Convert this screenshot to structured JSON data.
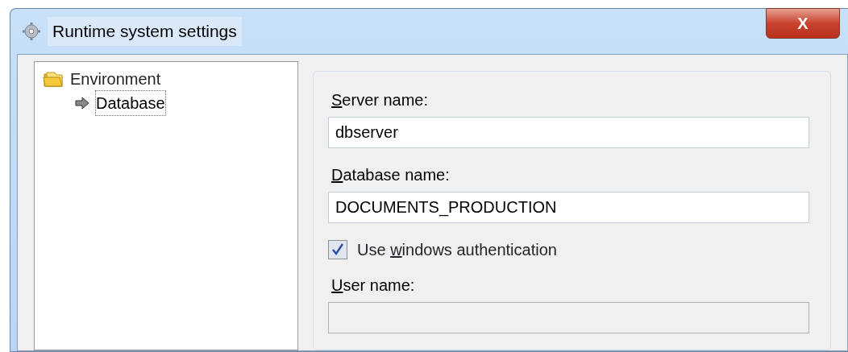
{
  "window": {
    "title": "Runtime system settings",
    "close_label": "X"
  },
  "tree": [
    {
      "label": "Environment",
      "kind": "folder",
      "selected": false,
      "children": [
        {
          "label": "Database",
          "kind": "arrow",
          "selected": true
        }
      ]
    }
  ],
  "form": [
    {
      "kind": "field",
      "label": [
        {
          "text": "S",
          "underlined": true
        },
        {
          "text": "erver name:",
          "underlined": false
        }
      ],
      "value": "dbserver",
      "disabled": false
    },
    {
      "kind": "field",
      "label": [
        {
          "text": "D",
          "underlined": true
        },
        {
          "text": "atabase name:",
          "underlined": false
        }
      ],
      "value": "DOCUMENTS_PRODUCTION",
      "disabled": false
    },
    {
      "kind": "checkbox",
      "label": [
        {
          "text": "Use ",
          "underlined": false
        },
        {
          "text": "w",
          "underlined": true
        },
        {
          "text": "indows authentication",
          "underlined": false
        }
      ],
      "checked": true
    },
    {
      "kind": "field",
      "label": [
        {
          "text": "U",
          "underlined": true
        },
        {
          "text": "ser name:",
          "underlined": false
        }
      ],
      "disabled": true
    }
  ]
}
